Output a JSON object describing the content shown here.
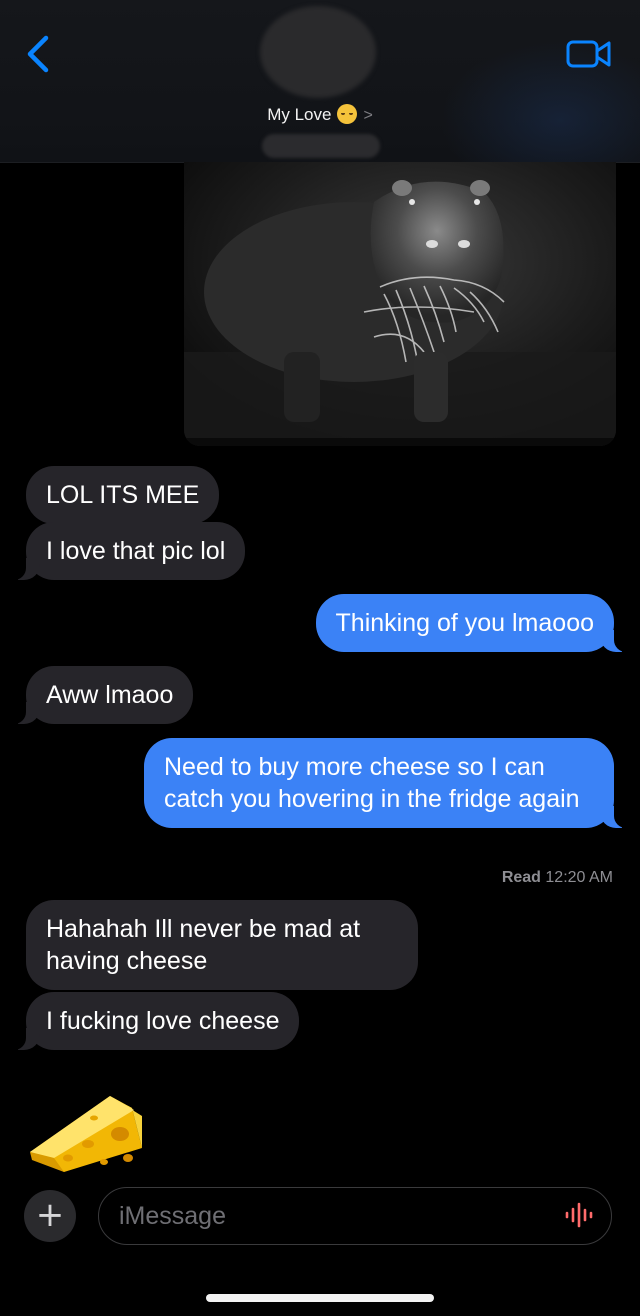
{
  "header": {
    "contact_name": "My Love",
    "contact_emoji": "smiling-face-with-hearts-icon",
    "chevron": ">",
    "back_icon": "chevron-left-icon",
    "video_icon": "video-camera-icon",
    "accent_color": "#0a84ff"
  },
  "photo": {
    "description_icon": "hippo-night-photo"
  },
  "messages": [
    {
      "direction": "incoming",
      "text": "LOL ITS MEE"
    },
    {
      "direction": "incoming",
      "text": "I love that pic lol"
    },
    {
      "direction": "outgoing",
      "text": "Thinking of you lmaooo"
    },
    {
      "direction": "incoming",
      "text": "Aww lmaoo"
    },
    {
      "direction": "outgoing",
      "text": "Need to buy more cheese so I can catch you hovering in the fridge again"
    },
    {
      "direction": "incoming",
      "text": "Hahahah Ill never be mad at having cheese"
    },
    {
      "direction": "incoming",
      "text": "I fucking love cheese"
    }
  ],
  "read_receipt": {
    "label": "Read",
    "time": "12:20 AM"
  },
  "cheese_emoji": "cheese-wedge-icon",
  "input": {
    "plus_label": "+",
    "placeholder": "iMessage",
    "audio_icon": "waveform-icon"
  },
  "colors": {
    "incoming_bubble": "#26252a",
    "outgoing_bubble": "#3b82f6",
    "audio_accent": "#ff6b6b"
  }
}
